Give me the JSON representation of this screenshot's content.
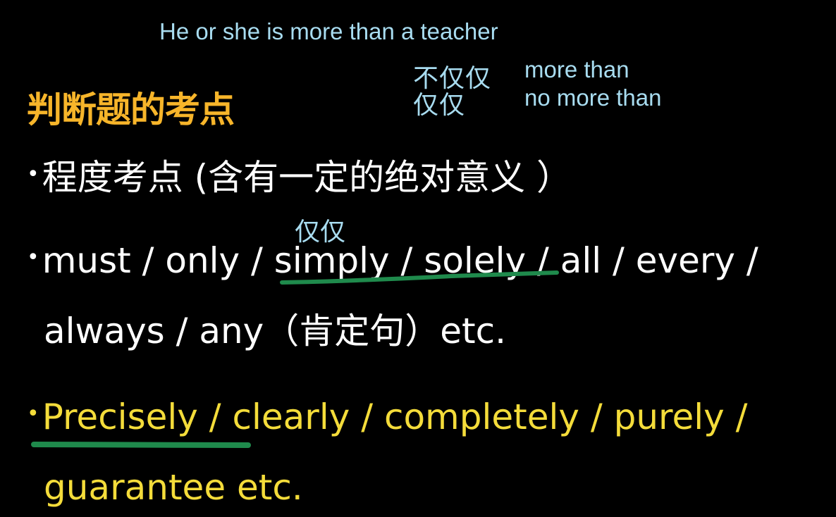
{
  "annotations": {
    "top_note": "He or she is more than a teacher",
    "cn_line1": "不仅仅",
    "cn_line2": "仅仅",
    "en_line1": "more than",
    "en_line2": "no more than",
    "above_simply": "仅仅"
  },
  "heading": "判断题的考点",
  "bullets": {
    "bullet_glyph": "•",
    "line1": "程度考点 (含有一定的绝对意义 ）",
    "line2": "must / only / simply / solely / all / every /",
    "line3": "always / any（肯定句）etc.",
    "line4": "Precisely / clearly / completely / purely /",
    "line5": "guarantee etc."
  },
  "colors": {
    "background": "#000000",
    "heading": "#f7b52a",
    "body_text": "#ffffff",
    "highlight_text": "#f4dc3a",
    "annotation": "#a8dcf0",
    "underline": "#1f8a4c"
  }
}
